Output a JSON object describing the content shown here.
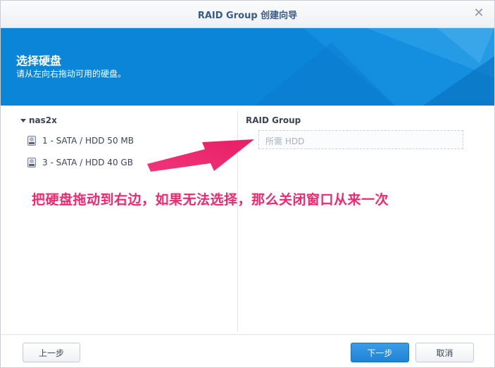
{
  "window": {
    "title": "RAID Group 创建向导",
    "close_glyph": "✕"
  },
  "banner": {
    "heading": "选择硬盘",
    "subheading": "请从左向右拖动可用的硬盘。"
  },
  "left_pane": {
    "root_label": "nas2x",
    "disks": [
      {
        "label": "1 - SATA / HDD 50 MB",
        "icon": "hard-disk-icon"
      },
      {
        "label": "3 - SATA / HDD 40 GB",
        "icon": "hard-disk-icon"
      }
    ]
  },
  "right_pane": {
    "title": "RAID Group",
    "dropzone_placeholder": "所需 HDD"
  },
  "annotation": {
    "text": "把硬盘拖动到右边，如果无法选择，那么关闭窗口从来一次",
    "color": "#f2276e"
  },
  "footer": {
    "prev_label": "上一步",
    "next_label": "下一步",
    "cancel_label": "取消"
  },
  "colors": {
    "banner": "#0a85d8",
    "primary_button": "#2a8cdc",
    "title_text": "#3b5a83"
  }
}
